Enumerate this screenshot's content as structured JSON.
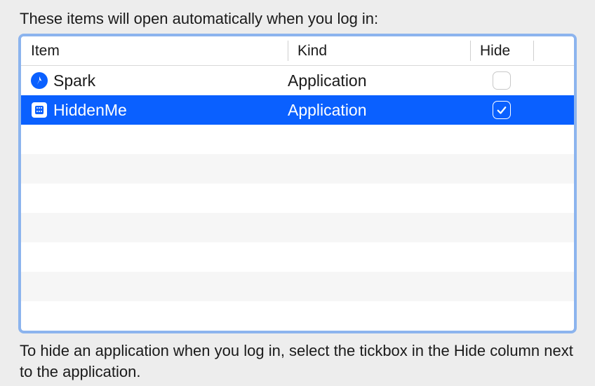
{
  "intro": "These items will open automatically when you log in:",
  "columns": {
    "item": "Item",
    "kind": "Kind",
    "hide": "Hide"
  },
  "items": [
    {
      "name": "Spark",
      "kind": "Application",
      "hide": false,
      "icon": "spark",
      "selected": false
    },
    {
      "name": "HiddenMe",
      "kind": "Application",
      "hide": true,
      "icon": "hiddenme",
      "selected": true
    }
  ],
  "empty_row_count": 7,
  "footer": "To hide an application when you log in, select the tickbox in the Hide column next to the application."
}
